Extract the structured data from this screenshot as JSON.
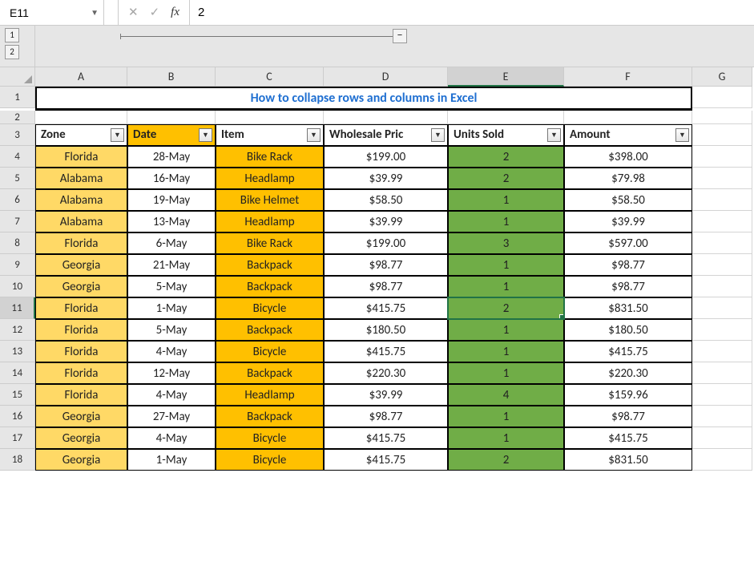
{
  "name_box": "E11",
  "formula_value": "2",
  "outline_levels": [
    "1",
    "2"
  ],
  "collapse_symbol": "−",
  "columns": [
    "A",
    "B",
    "C",
    "D",
    "E",
    "F",
    "G"
  ],
  "title": "How to collapse rows and columns in Excel",
  "headers": {
    "zone": "Zone",
    "date": "Date",
    "item": "Item",
    "price": "Wholesale Pric",
    "units": "Units Sold",
    "amount": "Amount"
  },
  "selected_column_index": 4,
  "selected_row": 11,
  "rows": [
    {
      "n": 4,
      "zone": "Florida",
      "date": "28-May",
      "item": "Bike Rack",
      "price": "$199.00",
      "units": "2",
      "amount": "$398.00"
    },
    {
      "n": 5,
      "zone": "Alabama",
      "date": "16-May",
      "item": "Headlamp",
      "price": "$39.99",
      "units": "2",
      "amount": "$79.98"
    },
    {
      "n": 6,
      "zone": "Alabama",
      "date": "19-May",
      "item": "Bike Helmet",
      "price": "$58.50",
      "units": "1",
      "amount": "$58.50"
    },
    {
      "n": 7,
      "zone": "Alabama",
      "date": "13-May",
      "item": "Headlamp",
      "price": "$39.99",
      "units": "1",
      "amount": "$39.99"
    },
    {
      "n": 8,
      "zone": "Florida",
      "date": "6-May",
      "item": "Bike Rack",
      "price": "$199.00",
      "units": "3",
      "amount": "$597.00"
    },
    {
      "n": 9,
      "zone": "Georgia",
      "date": "21-May",
      "item": "Backpack",
      "price": "$98.77",
      "units": "1",
      "amount": "$98.77"
    },
    {
      "n": 10,
      "zone": "Georgia",
      "date": "5-May",
      "item": "Backpack",
      "price": "$98.77",
      "units": "1",
      "amount": "$98.77"
    },
    {
      "n": 11,
      "zone": "Florida",
      "date": "1-May",
      "item": "Bicycle",
      "price": "$415.75",
      "units": "2",
      "amount": "$831.50"
    },
    {
      "n": 12,
      "zone": "Florida",
      "date": "5-May",
      "item": "Backpack",
      "price": "$180.50",
      "units": "1",
      "amount": "$180.50"
    },
    {
      "n": 13,
      "zone": "Florida",
      "date": "4-May",
      "item": "Bicycle",
      "price": "$415.75",
      "units": "1",
      "amount": "$415.75"
    },
    {
      "n": 14,
      "zone": "Florida",
      "date": "12-May",
      "item": "Backpack",
      "price": "$220.30",
      "units": "1",
      "amount": "$220.30"
    },
    {
      "n": 15,
      "zone": "Florida",
      "date": "4-May",
      "item": "Headlamp",
      "price": "$39.99",
      "units": "4",
      "amount": "$159.96"
    },
    {
      "n": 16,
      "zone": "Georgia",
      "date": "27-May",
      "item": "Backpack",
      "price": "$98.77",
      "units": "1",
      "amount": "$98.77"
    },
    {
      "n": 17,
      "zone": "Georgia",
      "date": "4-May",
      "item": "Bicycle",
      "price": "$415.75",
      "units": "1",
      "amount": "$415.75"
    },
    {
      "n": 18,
      "zone": "Georgia",
      "date": "1-May",
      "item": "Bicycle",
      "price": "$415.75",
      "units": "2",
      "amount": "$831.50"
    }
  ]
}
